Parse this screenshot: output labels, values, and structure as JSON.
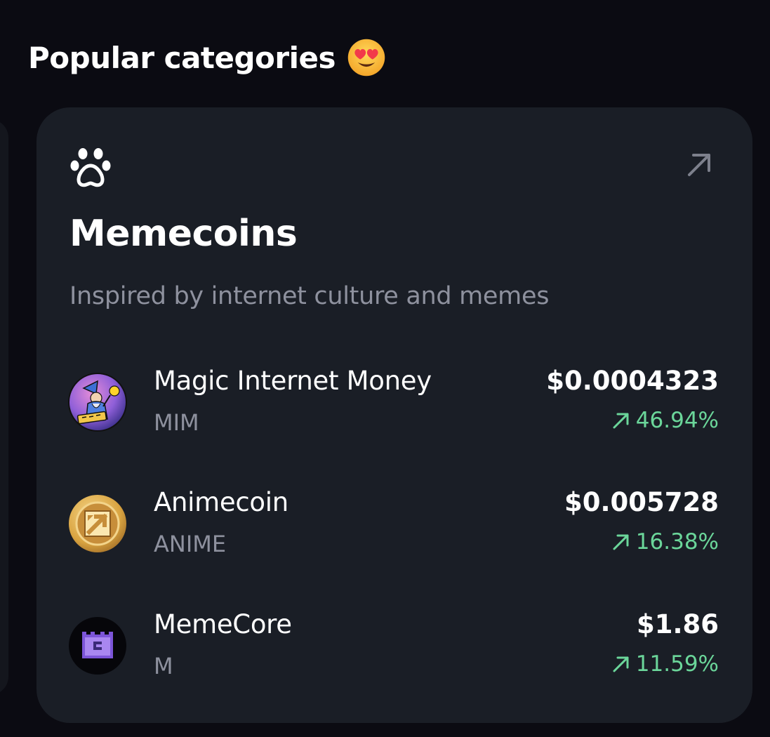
{
  "section": {
    "title": "Popular categories",
    "emoji": "heart-eyes-emoji"
  },
  "category": {
    "icon": "paw-icon",
    "link_icon": "arrow-up-right-icon",
    "name": "Memecoins",
    "description": "Inspired by internet culture and memes"
  },
  "coins": [
    {
      "name": "Magic Internet Money",
      "symbol": "MIM",
      "price": "$0.0004323",
      "change": "46.94%",
      "logo": "wizard-logo"
    },
    {
      "name": "Animecoin",
      "symbol": "ANIME",
      "price": "$0.005728",
      "change": "16.38%",
      "logo": "gold-coin-logo"
    },
    {
      "name": "MemeCore",
      "symbol": "M",
      "price": "$1.86",
      "change": "11.59%",
      "logo": "purple-block-logo"
    }
  ],
  "colors": {
    "background": "#0b0b12",
    "card": "#1a1e26",
    "muted_text": "#8e919e",
    "positive": "#6bd69a"
  }
}
